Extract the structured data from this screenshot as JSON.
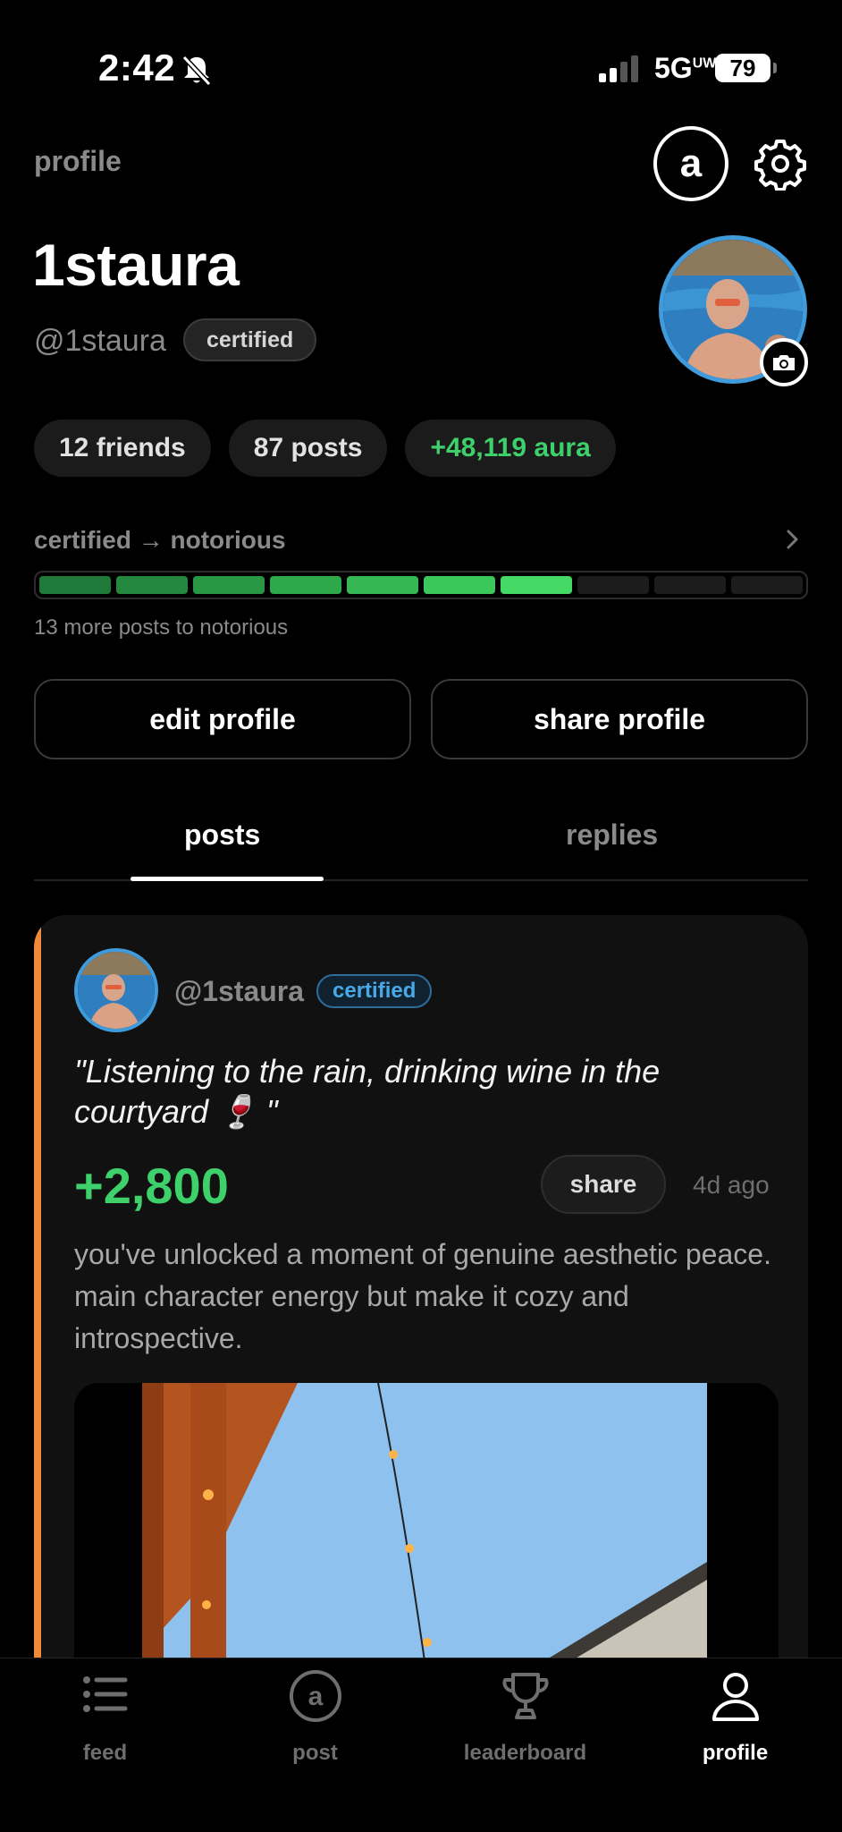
{
  "status_bar": {
    "time": "2:42",
    "network": "5G",
    "network_sup": "UW",
    "battery": "79"
  },
  "header": {
    "page_label": "profile",
    "logo_letter": "a"
  },
  "profile": {
    "display_name": "1staura",
    "handle": "@1staura",
    "badge": "certified",
    "stats": {
      "friends": "12 friends",
      "posts": "87 posts",
      "aura": "+48,119 aura"
    },
    "progress": {
      "title": "certified → notorious",
      "filled_segments": 7,
      "total_segments": 10,
      "caption": "13 more posts to notorious"
    },
    "edit_label": "edit profile",
    "share_label": "share profile"
  },
  "tabs": [
    {
      "label": "posts"
    },
    {
      "label": "replies"
    }
  ],
  "post": {
    "handle": "@1staura",
    "badge": "certified",
    "quote": "\"Listening to the rain, drinking wine in the courtyard 🍷 \"",
    "score": "+2,800",
    "share_label": "share",
    "time": "4d ago",
    "description": "you've unlocked a moment of genuine aesthetic peace. main character energy but make it cozy and introspective."
  },
  "nav": [
    {
      "label": "feed",
      "icon": "list-icon"
    },
    {
      "label": "post",
      "icon": "aura-logo-icon"
    },
    {
      "label": "leaderboard",
      "icon": "trophy-icon"
    },
    {
      "label": "profile",
      "icon": "person-icon"
    }
  ],
  "colors": {
    "accent_green": "#3ed06b",
    "avatar_ring": "#3f9bdc",
    "post_stripe": "#f0893a"
  }
}
